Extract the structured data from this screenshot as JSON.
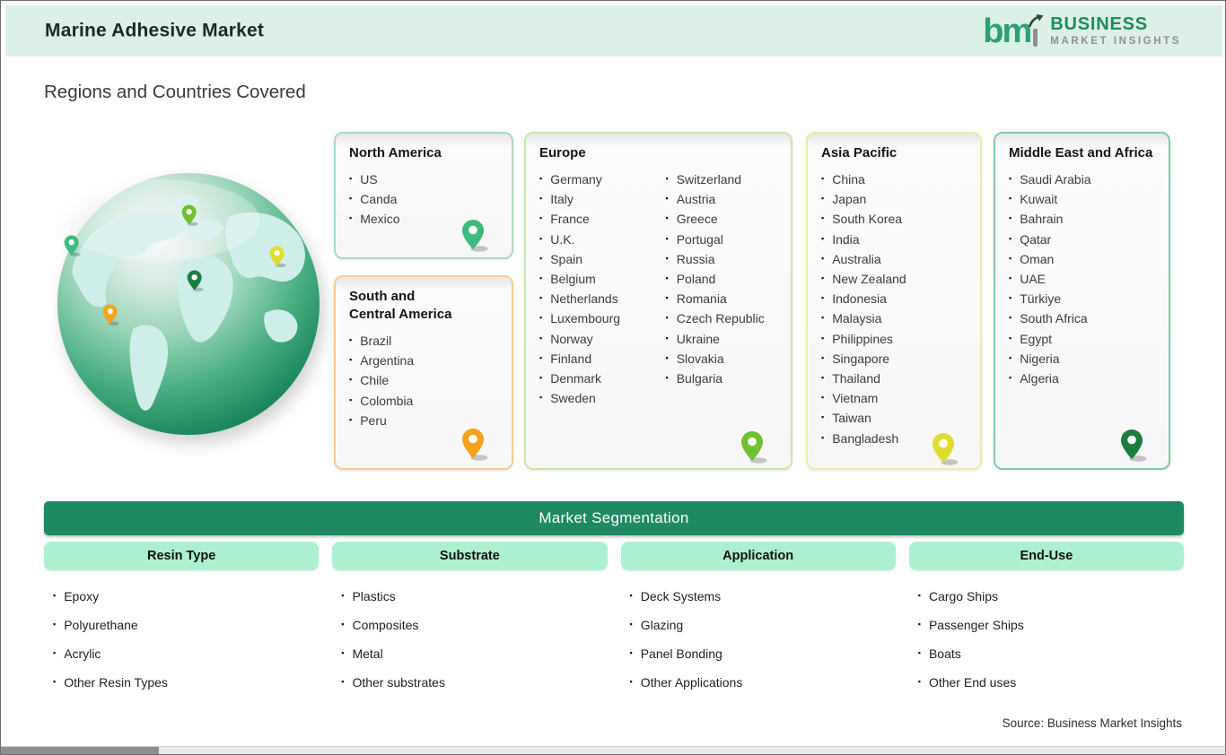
{
  "header": {
    "title": "Marine Adhesive Market"
  },
  "logo": {
    "mark_bm": "bm",
    "line1": "BUSINESS",
    "line2": "MARKET INSIGHTS"
  },
  "page": {
    "subtitle": "Regions and Countries Covered",
    "source": "Source: Business Market Insights"
  },
  "regions": [
    {
      "name": "North America",
      "countries": [
        "US",
        "Canda",
        "Mexico"
      ],
      "pin_color": "#3dbb7d",
      "border_color": "#a6dcc0"
    },
    {
      "name": "South and Central America",
      "countries": [
        "Brazil",
        "Argentina",
        "Chile",
        "Colombia",
        "Peru"
      ],
      "pin_color": "#f5a21c",
      "border_color": "#f6cb90"
    },
    {
      "name": "Europe",
      "countries": [
        "Germany",
        "Italy",
        "France",
        "U.K.",
        "Spain",
        "Belgium",
        "Netherlands",
        "Luxembourg",
        "Norway",
        "Finland",
        "Denmark",
        "Sweden",
        "Switzerland",
        "Austria",
        "Greece",
        "Portugal",
        "Russia",
        "Poland",
        "Romania",
        "Czech Republic",
        "Ukraine",
        "Slovakia",
        "Bulgaria"
      ],
      "pin_color": "#6fc230",
      "border_color": "#cde6a4"
    },
    {
      "name": "Asia Pacific",
      "countries": [
        "China",
        "Japan",
        "South Korea",
        "India",
        "Australia",
        "New Zealand",
        "Indonesia",
        "Malaysia",
        "Philippines",
        "Singapore",
        "Thailand",
        "Vietnam",
        "Taiwan",
        "Bangladesh"
      ],
      "pin_color": "#e0dd2e",
      "border_color": "#efeca6"
    },
    {
      "name": "Middle East and Africa",
      "countries": [
        "Saudi Arabia",
        "Kuwait",
        "Bahrain",
        "Qatar",
        "Oman",
        "UAE",
        "Türkiye",
        "South Africa",
        "Egypt",
        "Nigeria",
        "Algeria"
      ],
      "pin_color": "#1b7e3e",
      "border_color": "#83cba6"
    }
  ],
  "segmentation": {
    "title": "Market Segmentation",
    "columns": [
      {
        "label": "Resin Type",
        "items": [
          "Epoxy",
          "Polyurethane",
          "Acrylic",
          "Other Resin Types"
        ]
      },
      {
        "label": "Substrate",
        "items": [
          "Plastics",
          "Composites",
          "Metal",
          "Other substrates"
        ]
      },
      {
        "label": "Application",
        "items": [
          "Deck Systems",
          "Glazing",
          "Panel Bonding",
          "Other Applications"
        ]
      },
      {
        "label": "End-Use",
        "items": [
          "Cargo Ships",
          "Passenger Ships",
          "Boats",
          "Other End uses"
        ]
      }
    ]
  },
  "colors": {
    "header_bg": "#dcf0e7",
    "seg_bar_bg": "#1e8a62",
    "pill_bg": "#adf0d0",
    "logo_green": "#1f8a5e",
    "logo_gray": "#8f8f8f"
  }
}
